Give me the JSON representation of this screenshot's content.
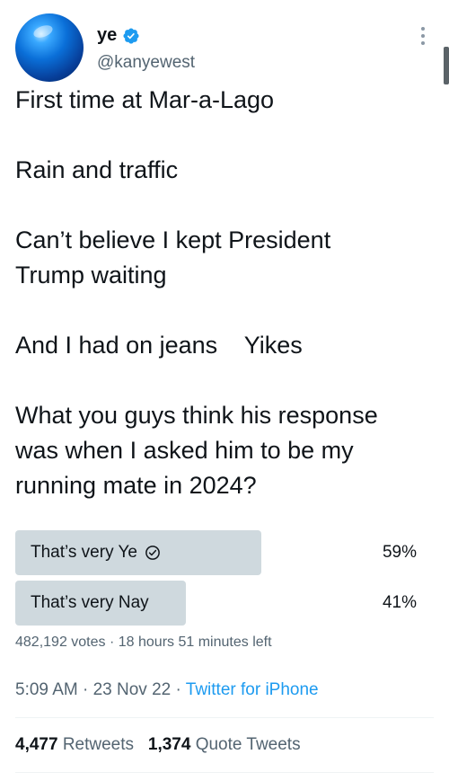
{
  "author": {
    "display_name": "ye",
    "handle": "@kanyewest",
    "avatar_icon": "blue-globe-avatar",
    "verified_icon": "verified-badge-icon",
    "verified_color": "#1d9bf0"
  },
  "tweet": {
    "lines": [
      "First time at Mar-a-Lago",
      "",
      "Rain and traffic",
      "",
      "Can’t believe I kept President",
      "Trump waiting",
      "",
      "And I had on jeans    Yikes",
      "",
      "What you guys think his response",
      "was when I asked him to be my",
      "running mate in 2024?"
    ]
  },
  "poll": {
    "options": [
      {
        "label": "That’s very Ye",
        "percent_text": "59%",
        "percent": 59,
        "selected": true
      },
      {
        "label": "That’s very Nay",
        "percent_text": "41%",
        "percent": 41,
        "selected": false
      }
    ],
    "votes": "482,192 votes",
    "separator": "·",
    "time_left": "18 hours 51 minutes left",
    "bar_color": "#cfd9de"
  },
  "meta": {
    "time": "5:09 AM",
    "date": "23 Nov 22",
    "separator": "·",
    "source": "Twitter for iPhone",
    "link_color": "#1d9bf0"
  },
  "stats": {
    "retweets_count": "4,477",
    "retweets_label": "Retweets",
    "quotes_count": "1,374",
    "quotes_label": "Quote Tweets"
  }
}
